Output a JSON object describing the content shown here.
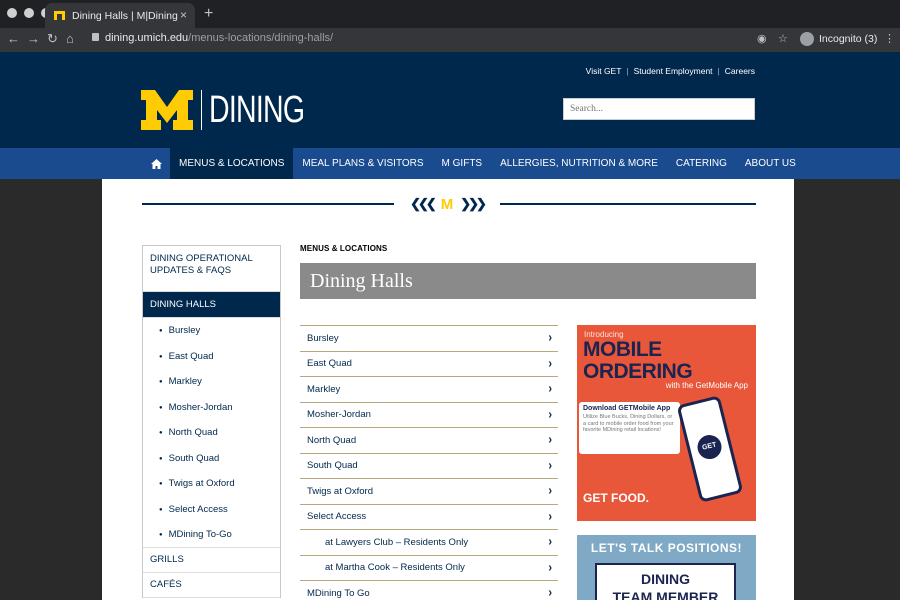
{
  "browser": {
    "tab_title": "Dining Halls | M|Dining",
    "tab_close": "×",
    "new_tab": "+",
    "url_host": "dining.umich.edu",
    "url_path": "/menus-locations/dining-halls/",
    "incognito_label": "Incognito (3)"
  },
  "header": {
    "top_links": [
      "Visit GET",
      "Student Employment",
      "Careers"
    ],
    "logo_text": "DINING",
    "search_placeholder": "Search..."
  },
  "nav": {
    "items": [
      "MENUS & LOCATIONS",
      "MEAL PLANS & VISITORS",
      "M GIFTS",
      "ALLERGIES, NUTRITION & MORE",
      "CATERING",
      "ABOUT US"
    ],
    "active_index": 0
  },
  "sidebar": {
    "top": "DINING OPERATIONAL UPDATES & FAQS",
    "active": "DINING HALLS",
    "subitems": [
      "Bursley",
      "East Quad",
      "Markley",
      "Mosher-Jordan",
      "North Quad",
      "South Quad",
      "Twigs at Oxford",
      "Select Access",
      "MDining To-Go"
    ],
    "after": [
      "GRILLS",
      "CAFÉS"
    ]
  },
  "main": {
    "kicker": "MENUS & LOCATIONS",
    "title": "Dining Halls",
    "halls": [
      {
        "label": "Bursley",
        "indent": false
      },
      {
        "label": "East Quad",
        "indent": false
      },
      {
        "label": "Markley",
        "indent": false
      },
      {
        "label": "Mosher-Jordan",
        "indent": false
      },
      {
        "label": "North Quad",
        "indent": false
      },
      {
        "label": "South Quad",
        "indent": false
      },
      {
        "label": "Twigs at Oxford",
        "indent": false
      },
      {
        "label": "Select Access",
        "indent": false
      },
      {
        "label": "at Lawyers Club – Residents Only",
        "indent": true
      },
      {
        "label": "at Martha Cook – Residents Only",
        "indent": true
      },
      {
        "label": "MDining To Go",
        "indent": false
      }
    ]
  },
  "ads": {
    "mobile": {
      "intro": "Introducing",
      "headline1": "MOBILE",
      "headline2": "ORDERING",
      "sub": "with the GetMobile App",
      "card_title": "Download GETMobile App",
      "card_body": "Utilize Blue Bucks, Dining Dollars, or a card to mobile order food from your favorite MDining retail locations!",
      "phone_text": "GET",
      "footer": "GET FOOD."
    },
    "positions": {
      "headline": "LET'S TALK POSITIONS!",
      "box_line1": "DINING",
      "box_line2": "TEAM MEMBER"
    }
  },
  "colors": {
    "maize": "#ffcb05",
    "blue": "#00274c",
    "nav_blue": "#1a4b8f"
  }
}
